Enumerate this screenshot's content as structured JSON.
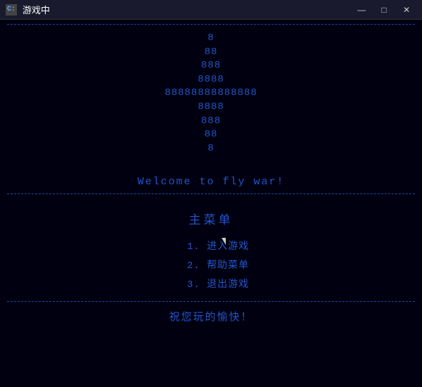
{
  "titlebar": {
    "icon": "C",
    "title": "游戏中",
    "minimize": "—",
    "maximize": "□",
    "close": "✕"
  },
  "ascii": {
    "lines": [
      "8",
      "88",
      "888",
      "8888",
      "88888888888888",
      "8888",
      "888",
      "88",
      "8"
    ]
  },
  "welcome": {
    "text": "Welcome to fly war!"
  },
  "menu": {
    "title": "主菜单",
    "items": [
      "1.  进入游戏",
      "2.  帮助菜单",
      "3.  退出游戏"
    ]
  },
  "footer": {
    "text": "祝您玩的愉快！"
  }
}
